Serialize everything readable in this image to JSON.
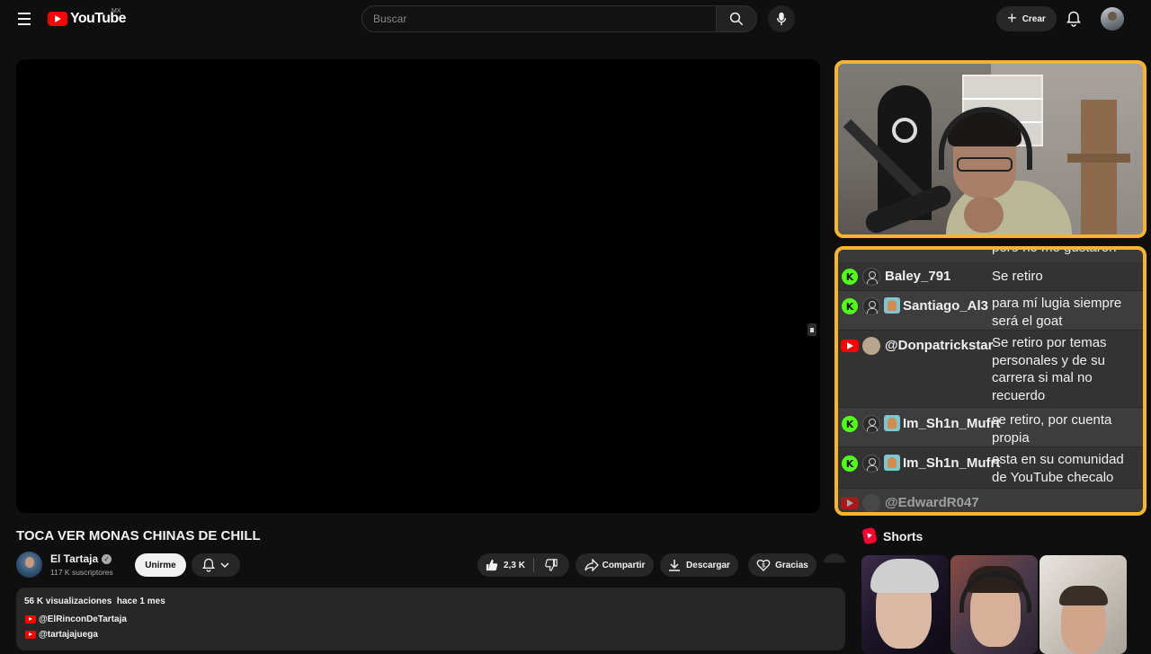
{
  "header": {
    "logo_text": "YouTube",
    "region": "MX",
    "search_placeholder": "Buscar",
    "create_label": "Crear"
  },
  "stream_overlay": {
    "cut_off_message": "pero no me gustaron",
    "messages": [
      {
        "platform": "kick",
        "username": "Baley_791",
        "has_sub_badge": false,
        "text": "Se retiro"
      },
      {
        "platform": "kick",
        "username": "Santiago_Al3",
        "has_sub_badge": true,
        "text": "para mí lugia siempre será el goat"
      },
      {
        "platform": "youtube",
        "username": "@Donpatrickstar",
        "has_sub_badge": false,
        "text": "Se retiro por temas personales y de su carrera si mal no recuerdo"
      },
      {
        "platform": "kick",
        "username": "Im_Sh1n_Mufrt",
        "has_sub_badge": true,
        "text": "se retiro, por cuenta propia"
      },
      {
        "platform": "kick",
        "username": "Im_Sh1n_Mufrt",
        "has_sub_badge": true,
        "text": "esta en su comunidad de YouTube checalo"
      },
      {
        "platform": "youtube",
        "username": "@EdwardR047",
        "has_sub_badge": false,
        "text": ""
      }
    ],
    "border_color": "#f7b52c"
  },
  "video": {
    "title": "TOCA VER MONAS CHINAS DE CHILL",
    "channel_name": "El Tartaja",
    "subscribers": "117 K suscriptores",
    "join_label": "Unirme",
    "likes": "2,3 K",
    "share_label": "Compartir",
    "download_label": "Descargar",
    "thanks_label": "Gracias"
  },
  "description": {
    "views": "56 K visualizaciones",
    "date": "hace 1 mes",
    "links": [
      "@ElRinconDeTartaja",
      "@tartajajuega"
    ]
  },
  "sidebar": {
    "shorts_title": "Shorts"
  },
  "colors": {
    "background": "#0f0f0f",
    "brand_red": "#ff0000",
    "kick_green": "#53fc18",
    "pill_bg": "#272727"
  }
}
